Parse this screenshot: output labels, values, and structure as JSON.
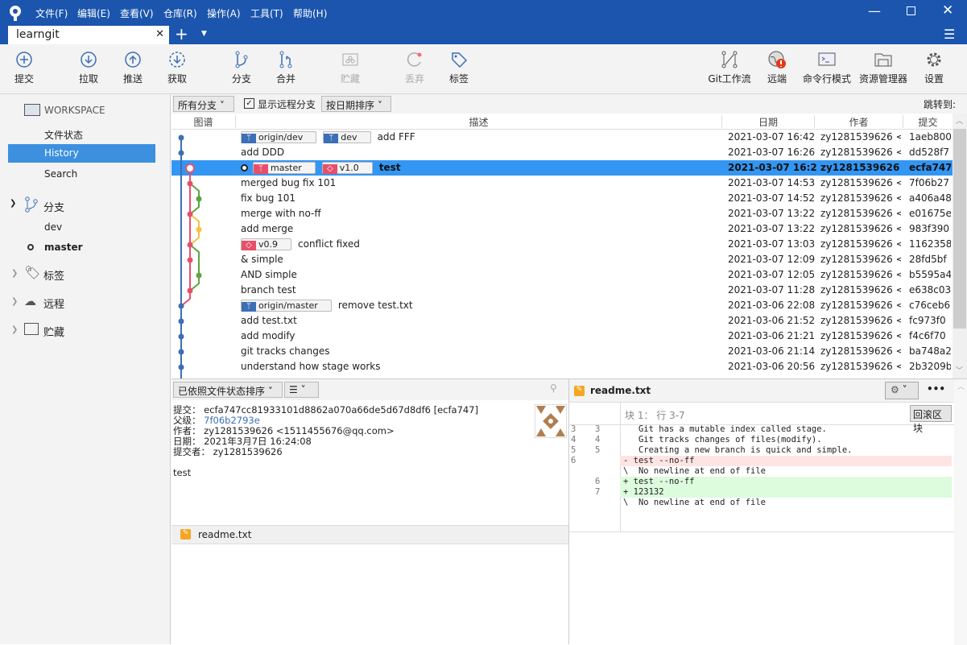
{
  "app": {
    "menus": [
      "文件(F)",
      "编辑(E)",
      "查看(V)",
      "仓库(R)",
      "操作(A)",
      "工具(T)",
      "帮助(H)"
    ],
    "tab": "learngit"
  },
  "toolbar": {
    "left": [
      {
        "label": "提交",
        "icon": "plus-circle-icon"
      },
      {
        "label": "拉取",
        "icon": "arrow-down-circle-icon"
      },
      {
        "label": "推送",
        "icon": "arrow-up-circle-icon"
      },
      {
        "label": "获取",
        "icon": "fetch-icon"
      },
      {
        "label": "分支",
        "icon": "branch-icon"
      },
      {
        "label": "合并",
        "icon": "merge-icon"
      },
      {
        "label": "贮藏",
        "icon": "stash-icon",
        "disabled": true
      },
      {
        "label": "丢弃",
        "icon": "discard-icon",
        "disabled": true
      },
      {
        "label": "标签",
        "icon": "tag-icon"
      }
    ],
    "right": [
      {
        "label": "Git工作流",
        "icon": "gitflow-icon"
      },
      {
        "label": "远端",
        "icon": "globe-icon"
      },
      {
        "label": "命令行模式",
        "icon": "terminal-icon"
      },
      {
        "label": "资源管理器",
        "icon": "folder-icon"
      },
      {
        "label": "设置",
        "icon": "gear-icon"
      }
    ]
  },
  "sidebar": {
    "workspace": "WORKSPACE",
    "workspace_items": [
      "文件状态",
      "History",
      "Search"
    ],
    "selected": "History",
    "branches_label": "分支",
    "branches": [
      "dev",
      "master"
    ],
    "current_branch": "master",
    "tags_label": "标签",
    "remotes_label": "远程",
    "stashes_label": "贮藏"
  },
  "filter": {
    "branches": "所有分支",
    "show_remote": "显示远程分支",
    "show_remote_checked": true,
    "sort": "按日期排序",
    "jump": "跳转到:"
  },
  "columns": [
    "图谱",
    "描述",
    "日期",
    "作者",
    "提交"
  ],
  "colors": {
    "blue": "#3b6fb6",
    "red": "#e8506a",
    "green": "#5ba640",
    "yellow": "#f5c244",
    "selection": "#3396f3"
  },
  "commits": [
    {
      "refs": [
        {
          "name": "origin/dev",
          "type": "branch",
          "color": "#3b6fb6"
        },
        {
          "name": "dev",
          "type": "branch",
          "color": "#3b6fb6"
        }
      ],
      "msg": "add FFF",
      "date": "2021-03-07 16:42",
      "author": "zy1281539626 <'",
      "hash": "1aeb800",
      "lane": 0,
      "color": "#3b6fb6"
    },
    {
      "refs": [],
      "msg": "add DDD",
      "date": "2021-03-07 16:26",
      "author": "zy1281539626 <'",
      "hash": "dd528f7",
      "lane": 0,
      "color": "#3b6fb6"
    },
    {
      "refs": [
        {
          "name": "master",
          "type": "branch",
          "color": "#e8506a"
        },
        {
          "name": "v1.0",
          "type": "tag",
          "color": "#e8506a"
        }
      ],
      "head": true,
      "selected": true,
      "msg": "test",
      "date": "2021-03-07 16:24",
      "author": "zy1281539626 <'",
      "hash": "ecfa747",
      "lane": 1,
      "color": "#e8506a"
    },
    {
      "refs": [],
      "msg": "merged bug fix 101",
      "date": "2021-03-07 14:53",
      "author": "zy1281539626 <'",
      "hash": "7f06b27",
      "lane": 1,
      "color": "#e8506a"
    },
    {
      "refs": [],
      "msg": "fix bug 101",
      "date": "2021-03-07 14:52",
      "author": "zy1281539626 <'",
      "hash": "a406a48",
      "lane": 2,
      "color": "#5ba640"
    },
    {
      "refs": [],
      "msg": "merge with no-ff",
      "date": "2021-03-07 13:22",
      "author": "zy1281539626 <'",
      "hash": "e01675e",
      "lane": 1,
      "color": "#e8506a"
    },
    {
      "refs": [],
      "msg": "add merge",
      "date": "2021-03-07 13:22",
      "author": "zy1281539626 <'",
      "hash": "983f390",
      "lane": 2,
      "color": "#f5c244"
    },
    {
      "refs": [
        {
          "name": "v0.9",
          "type": "tag",
          "color": "#e8506a"
        }
      ],
      "msg": "conflict fixed",
      "date": "2021-03-07 13:03",
      "author": "zy1281539626 <'",
      "hash": "1162358",
      "lane": 1,
      "color": "#e8506a"
    },
    {
      "refs": [],
      "msg": "& simple",
      "date": "2021-03-07 12:09",
      "author": "zy1281539626 <'",
      "hash": "28fd5bf",
      "lane": 1,
      "color": "#e8506a"
    },
    {
      "refs": [],
      "msg": "AND simple",
      "date": "2021-03-07 12:05",
      "author": "zy1281539626 <'",
      "hash": "b5595a4",
      "lane": 2,
      "color": "#5ba640"
    },
    {
      "refs": [],
      "msg": "branch test",
      "date": "2021-03-07 11:28",
      "author": "zy1281539626 <'",
      "hash": "e638c03",
      "lane": 1,
      "color": "#e8506a"
    },
    {
      "refs": [
        {
          "name": "origin/master",
          "type": "branch",
          "color": "#3b6fb6"
        }
      ],
      "msg": "remove test.txt",
      "date": "2021-03-06 22:08",
      "author": "zy1281539626 <'",
      "hash": "c76ceb6",
      "lane": 0,
      "color": "#3b6fb6"
    },
    {
      "refs": [],
      "msg": "add test.txt",
      "date": "2021-03-06 21:52",
      "author": "zy1281539626 <'",
      "hash": "fc973f0",
      "lane": 0,
      "color": "#3b6fb6"
    },
    {
      "refs": [],
      "msg": "add modify",
      "date": "2021-03-06 21:21",
      "author": "zy1281539626 <'",
      "hash": "f4c6f70",
      "lane": 0,
      "color": "#3b6fb6"
    },
    {
      "refs": [],
      "msg": "git tracks changes",
      "date": "2021-03-06 21:14",
      "author": "zy1281539626 <'",
      "hash": "ba748a2",
      "lane": 0,
      "color": "#3b6fb6"
    },
    {
      "refs": [],
      "msg": "understand how stage works",
      "date": "2021-03-06 20:56",
      "author": "zy1281539626 <'",
      "hash": "2b3209b",
      "lane": 0,
      "color": "#3b6fb6"
    }
  ],
  "graph_edges": [
    [
      0,
      1
    ],
    [
      1,
      11
    ],
    [
      2,
      3
    ],
    [
      3,
      4
    ],
    [
      3,
      5
    ],
    [
      4,
      5
    ],
    [
      5,
      6
    ],
    [
      5,
      7
    ],
    [
      6,
      7
    ],
    [
      7,
      8
    ],
    [
      7,
      9
    ],
    [
      8,
      10
    ],
    [
      9,
      10
    ],
    [
      10,
      11
    ],
    [
      11,
      12
    ],
    [
      12,
      13
    ],
    [
      13,
      14
    ],
    [
      14,
      15
    ]
  ],
  "details": {
    "sort": "已依照文件状态排序",
    "commit_label": "提交：",
    "commit": "ecfa747cc81933101d8862a070a66de5d67d8df6 [ecfa747]",
    "parent_label": "父级：",
    "parent": "7f06b2793e",
    "author_label": "作者：",
    "author": "zy1281539626 <1511455676@qq.com>",
    "date_label": "日期：",
    "date": "2021年3月7日 16:24:08",
    "committer_label": "提交者：",
    "committer": "zy1281539626",
    "message": "test",
    "files": [
      "readme.txt"
    ]
  },
  "diff": {
    "file": "readme.txt",
    "hunk": "块 1： 行 3-7",
    "revert": "回滚区块",
    "lines": [
      {
        "old": "3",
        "new": "3",
        "text": "   Git has a mutable index called stage.",
        "type": "ctx"
      },
      {
        "old": "4",
        "new": "4",
        "text": "   Git tracks changes of files(modify).",
        "type": "ctx"
      },
      {
        "old": "5",
        "new": "5",
        "text": "   Creating a new branch is quick and simple.",
        "type": "ctx"
      },
      {
        "old": "6",
        "new": "",
        "text": "- test --no-ff",
        "type": "del"
      },
      {
        "old": "",
        "new": "",
        "text": "\\  No newline at end of file",
        "type": "ctx"
      },
      {
        "old": "",
        "new": "6",
        "text": "+ test --no-ff",
        "type": "add"
      },
      {
        "old": "",
        "new": "7",
        "text": "+ 123132",
        "type": "add"
      },
      {
        "old": "",
        "new": "",
        "text": "\\  No newline at end of file",
        "type": "ctx"
      }
    ]
  }
}
